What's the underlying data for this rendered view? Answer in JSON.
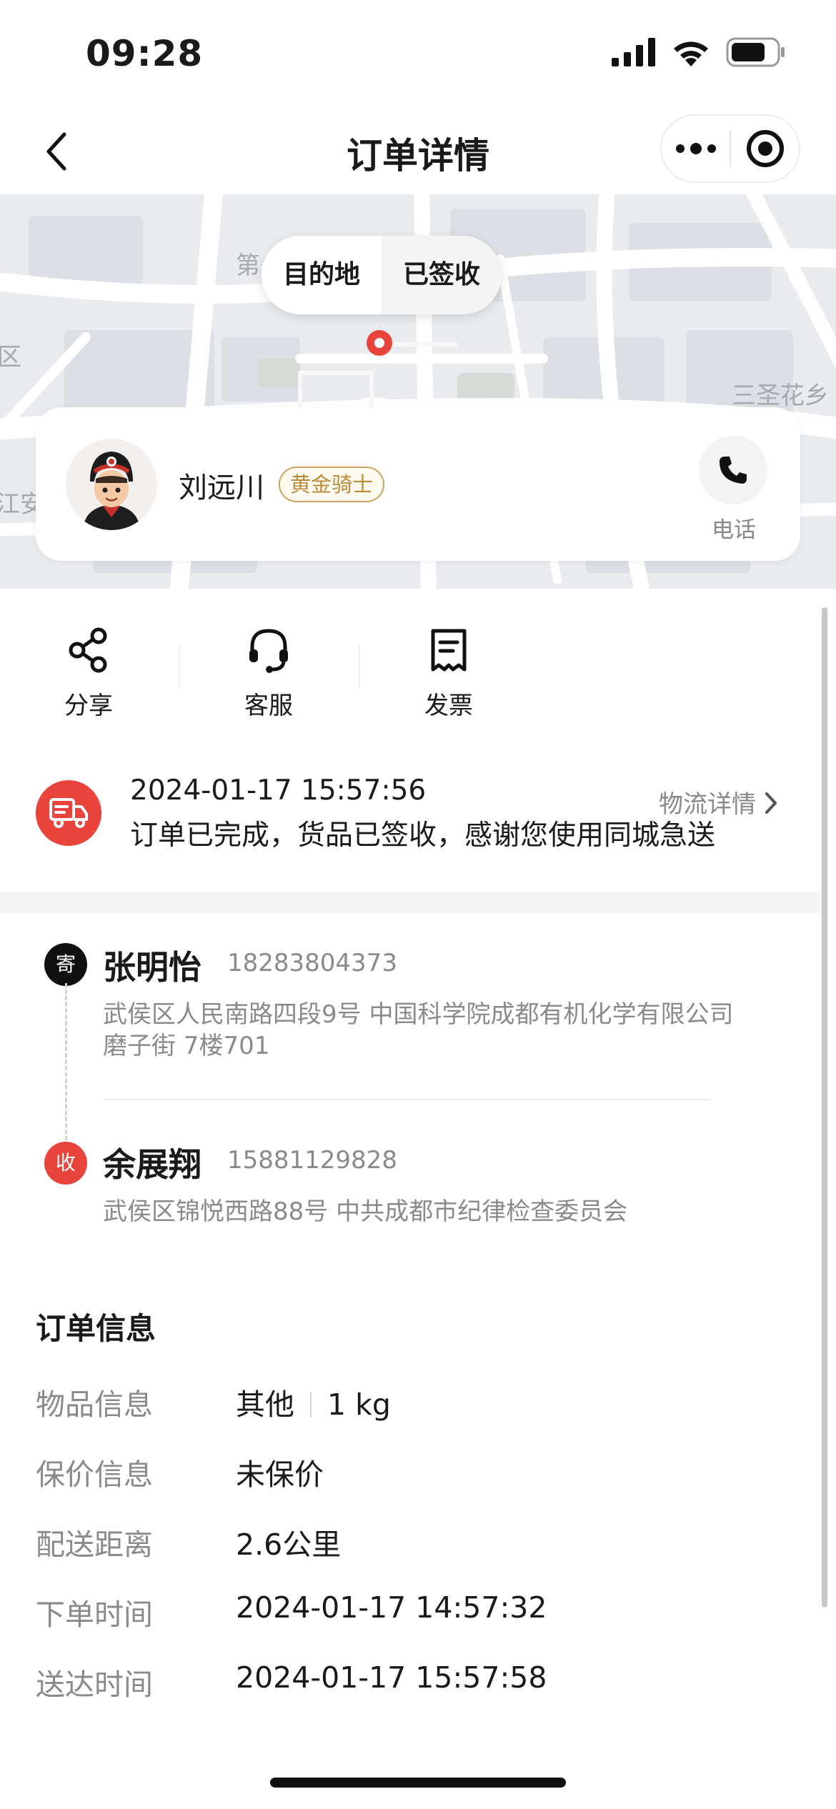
{
  "status_bar": {
    "time": "09:28",
    "icons": [
      "signal-icon",
      "wifi-icon",
      "battery-icon"
    ]
  },
  "nav": {
    "title": "订单详情",
    "back_icon": "chevron-left-icon",
    "more_icon": "more-dots-icon",
    "close_icon": "target-circle-icon"
  },
  "map": {
    "pill_left": "目的地",
    "pill_right": "已签收",
    "labels": {
      "top_left": "第",
      "left_edge": "区",
      "left_bottom": "江安",
      "right": "三圣花乡"
    }
  },
  "rider": {
    "name": "刘远川",
    "badge": "黄金骑士",
    "phone_label": "电话"
  },
  "actions": [
    {
      "label": "分享",
      "icon": "share-icon"
    },
    {
      "label": "客服",
      "icon": "headset-icon"
    },
    {
      "label": "发票",
      "icon": "invoice-icon"
    }
  ],
  "order_status": {
    "time": "2024-01-17 15:57:56",
    "desc": "订单已完成，货品已签收，感谢您使用同城急送",
    "link": "物流详情",
    "icon": "delivery-truck-icon"
  },
  "sender": {
    "tag": "寄",
    "name": "张明怡",
    "phone": "18283804373",
    "address_line1": "武侯区人民南路四段9号 中国科学院成都有机化学有限公司",
    "address_line2": "磨子街 7楼701"
  },
  "receiver": {
    "tag": "收",
    "name": "余展翔",
    "phone": "15881129828",
    "address_line1": "武侯区锦悦西路88号 中共成都市纪律检查委员会"
  },
  "order_info": {
    "title": "订单信息",
    "rows": [
      {
        "label": "物品信息",
        "value": "其他",
        "value2": "1 kg"
      },
      {
        "label": "保价信息",
        "value": "未保价"
      },
      {
        "label": "配送距离",
        "value": "2.6公里"
      },
      {
        "label": "下单时间",
        "value": "2024-01-17 14:57:32"
      },
      {
        "label": "送达时间",
        "value": "2024-01-17 15:57:58"
      }
    ]
  },
  "colors": {
    "accent_red": "#e8443c",
    "gold": "#c9a35f",
    "muted": "#8a8a8a",
    "map_bg": "#e9ebee"
  }
}
